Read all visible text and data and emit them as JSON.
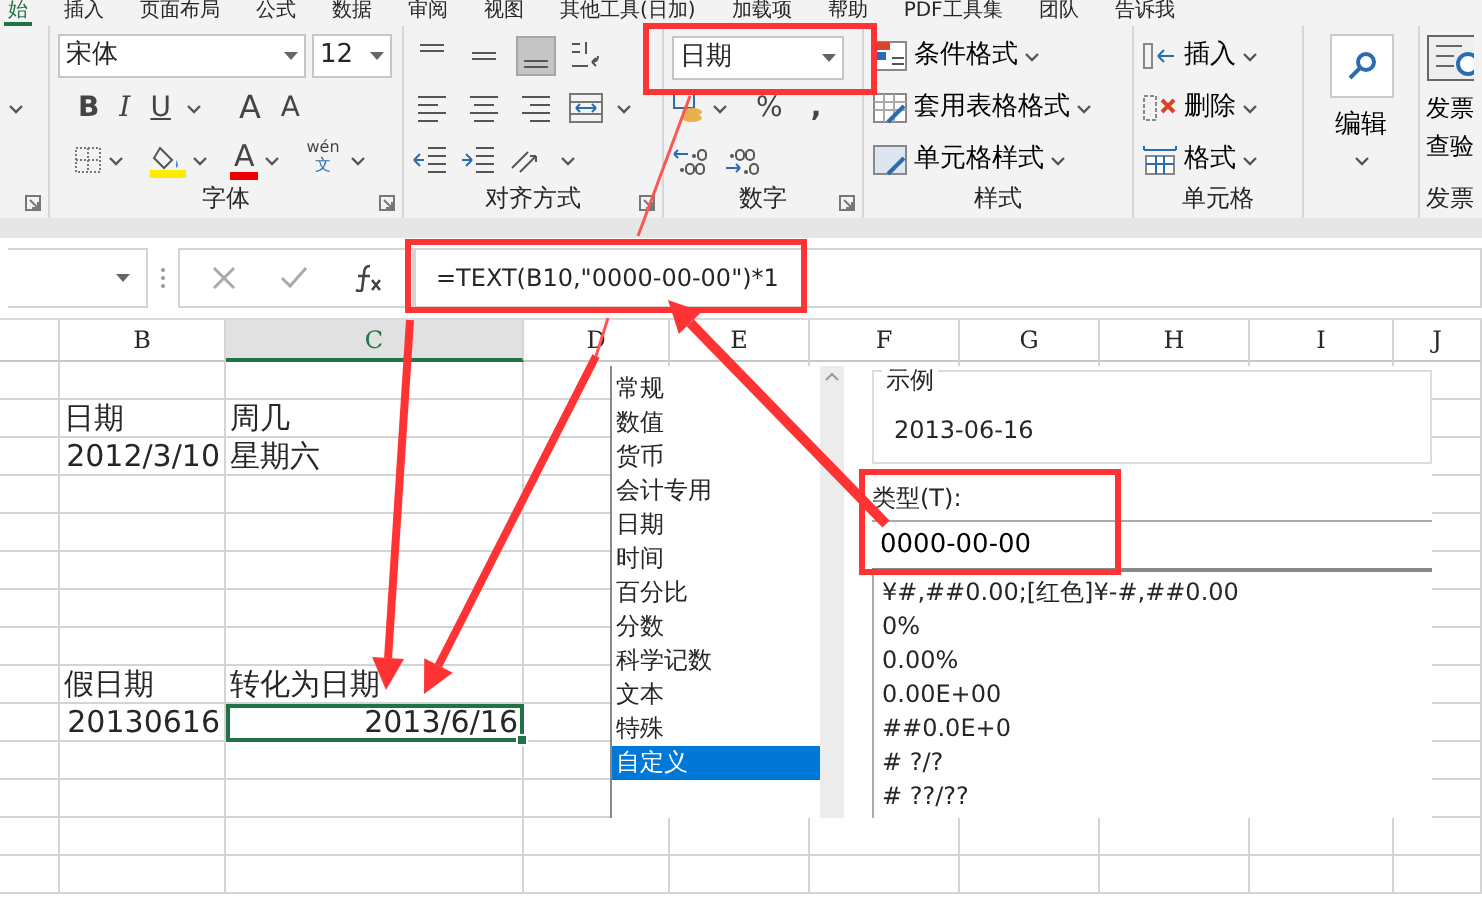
{
  "ribbon_tabs": [
    {
      "label": "始",
      "selected": true
    },
    {
      "label": "插入",
      "selected": false
    },
    {
      "label": "页面布局",
      "selected": false
    },
    {
      "label": "公式",
      "selected": false
    },
    {
      "label": "数据",
      "selected": false
    },
    {
      "label": "审阅",
      "selected": false
    },
    {
      "label": "视图",
      "selected": false
    },
    {
      "label": "其他工具(日加)",
      "selected": false
    },
    {
      "label": "加载项",
      "selected": false
    },
    {
      "label": "帮助",
      "selected": false
    },
    {
      "label": "PDF工具集",
      "selected": false
    },
    {
      "label": "团队",
      "selected": false
    },
    {
      "label": "告诉我",
      "selected": false
    }
  ],
  "font_group": {
    "font_name": "宋体",
    "font_size": "12",
    "bold": "B",
    "italic": "I",
    "underline": "U",
    "grow": "A",
    "shrink": "A",
    "font_color": "A",
    "phonetic_top": "wén",
    "phonetic_bottom": "文",
    "label": "字体"
  },
  "alignment_group": {
    "label": "对齐方式"
  },
  "number_group": {
    "format": "日期",
    "percent": "%",
    "comma": ",",
    "label": "数字"
  },
  "styles_group": {
    "items": [
      "条件格式",
      "套用表格格式",
      "单元格样式"
    ],
    "label": "样式"
  },
  "cells_group": {
    "items": [
      "插入",
      "删除",
      "格式"
    ],
    "label": "单元格"
  },
  "editing_group": {
    "label": "编辑"
  },
  "invoice_group": {
    "button": [
      "发票",
      "查验"
    ],
    "label": "发票"
  },
  "formula_bar": {
    "formula": "=TEXT(B10,\"0000-00-00\")*1"
  },
  "columns": [
    "B",
    "C",
    "D",
    "E",
    "F",
    "G",
    "H",
    "I",
    "J"
  ],
  "rows": [
    {},
    {
      "B": {
        "text": "日期",
        "kind": "text",
        "selected": false
      },
      "C": {
        "text": "周几",
        "kind": "text",
        "selected": false
      }
    },
    {
      "B": {
        "text": "2012/3/10",
        "kind": "number",
        "selected": false
      },
      "C": {
        "text": "星期六",
        "kind": "text",
        "selected": false
      }
    },
    {},
    {},
    {},
    {},
    {},
    {
      "B": {
        "text": "假日期",
        "kind": "text",
        "selected": false
      },
      "C": {
        "text": "转化为日期",
        "kind": "text",
        "selected": false
      }
    },
    {
      "B": {
        "text": "20130616",
        "kind": "number",
        "selected": false
      },
      "C": {
        "text": "2013/6/16",
        "kind": "number",
        "selected": true
      }
    },
    {},
    {},
    {},
    {}
  ],
  "format_dialog": {
    "categories": [
      {
        "label": "常规",
        "selected": false
      },
      {
        "label": "数值",
        "selected": false
      },
      {
        "label": "货币",
        "selected": false
      },
      {
        "label": "会计专用",
        "selected": false
      },
      {
        "label": "日期",
        "selected": false
      },
      {
        "label": "时间",
        "selected": false
      },
      {
        "label": "百分比",
        "selected": false
      },
      {
        "label": "分数",
        "selected": false
      },
      {
        "label": "科学记数",
        "selected": false
      },
      {
        "label": "文本",
        "selected": false
      },
      {
        "label": "特殊",
        "selected": false
      },
      {
        "label": "自定义",
        "selected": true
      }
    ],
    "sample_label": "示例",
    "sample": "2013-06-16",
    "type_label": "类型(T):",
    "type_value": "0000-00-00",
    "formats": [
      "¥#,##0.00;[红色]¥-#,##0.00",
      "0%",
      "0.00%",
      "0.00E+00",
      "##0.0E+0",
      "# ?/?",
      "# ??/??"
    ]
  }
}
